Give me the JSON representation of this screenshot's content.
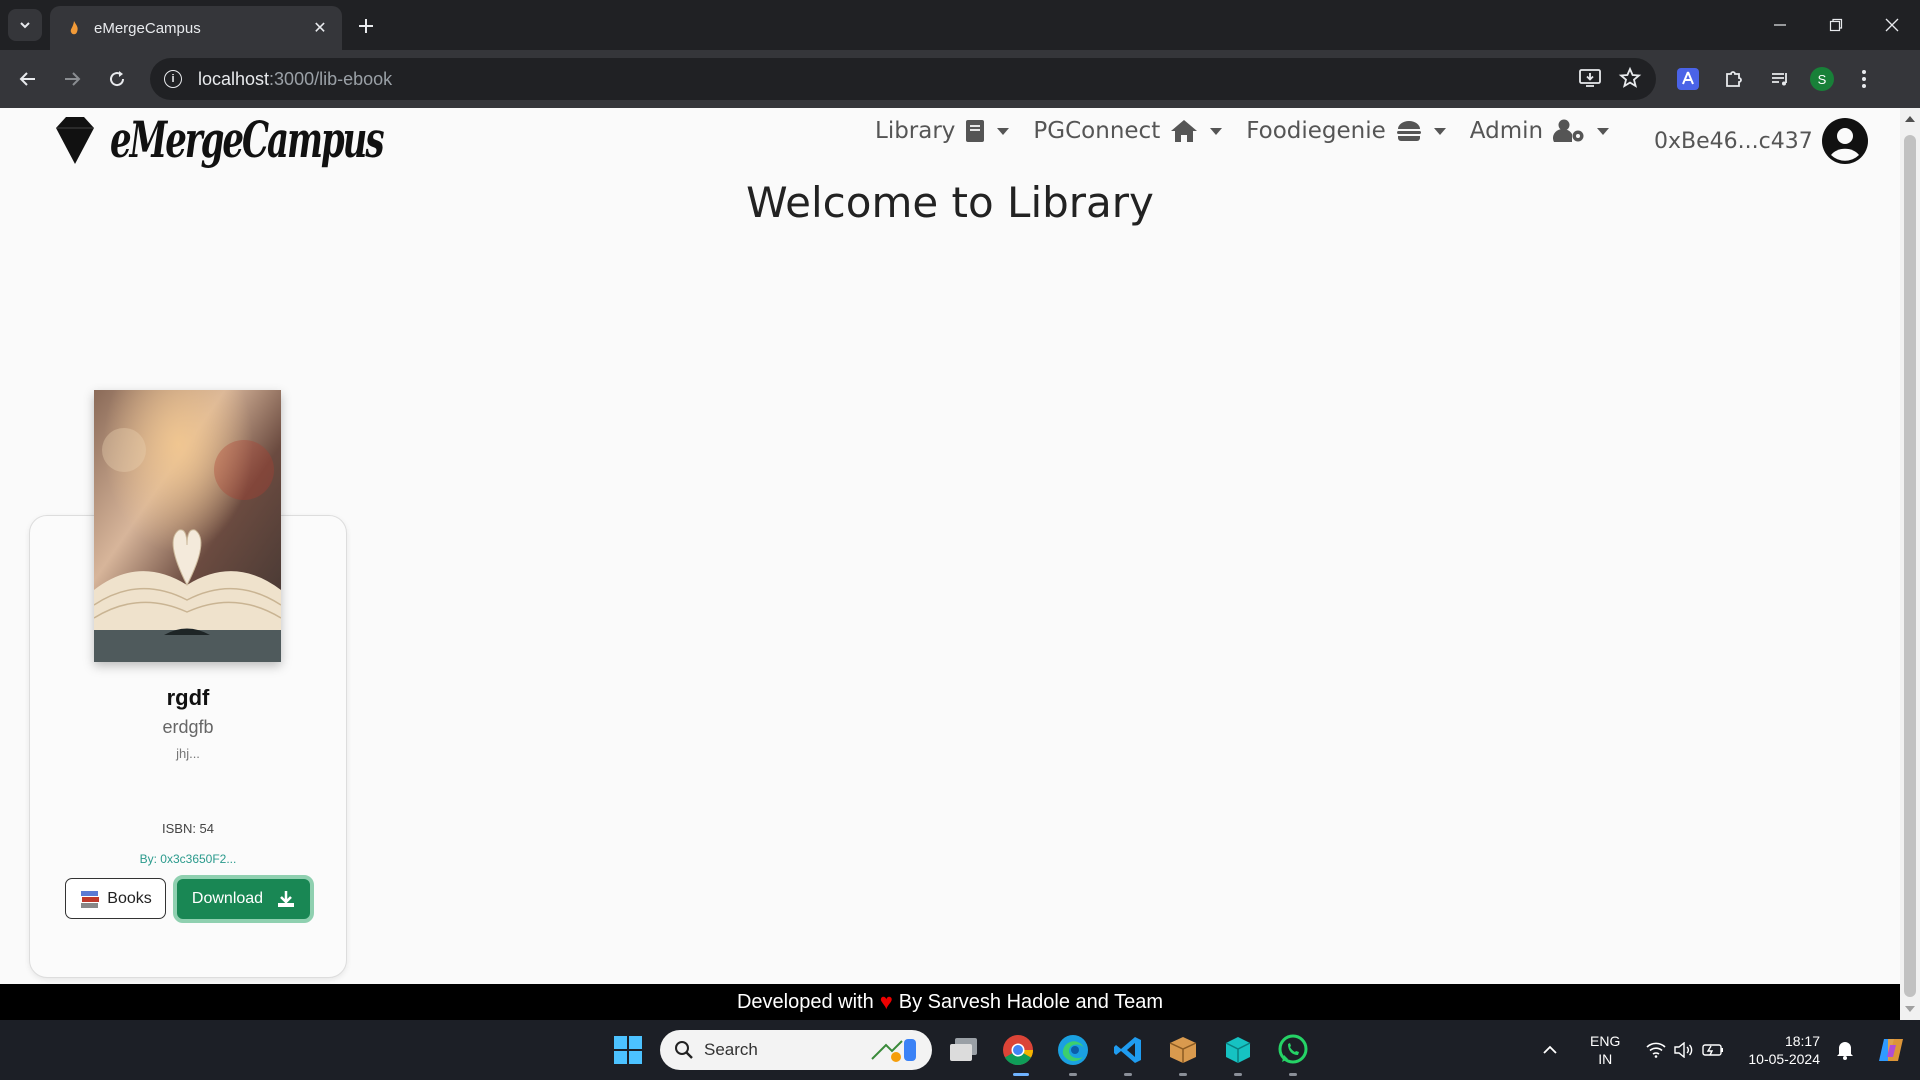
{
  "browser": {
    "tab_title": "eMergeCampus",
    "url_host": "localhost",
    "url_path": ":3000/lib-ebook",
    "profile_initial": "S"
  },
  "site": {
    "logo_text": "eMergeCampus",
    "nav": [
      {
        "label": "Library",
        "icon": "book-icon"
      },
      {
        "label": "PGConnect",
        "icon": "home-icon"
      },
      {
        "label": "Foodiegenie",
        "icon": "burger-icon"
      },
      {
        "label": "Admin",
        "icon": "user-gear-icon"
      }
    ],
    "account": "0xBe46...c437",
    "heading": "Welcome to Library"
  },
  "book": {
    "title": "rgdf",
    "author": "erdgfb",
    "description": "jhj...",
    "isbn": "ISBN: 54",
    "by": "By: 0x3c3650F2...",
    "books_button": "Books",
    "download_button": "Download"
  },
  "footer": {
    "prefix": "Developed with",
    "suffix": "By Sarvesh Hadole and Team"
  },
  "taskbar": {
    "search_placeholder": "Search",
    "lang_line1": "ENG",
    "lang_line2": "IN",
    "time": "18:17",
    "date": "10-05-2024"
  },
  "colors": {
    "download_green": "#198754",
    "footer_heart": "#e00000"
  }
}
